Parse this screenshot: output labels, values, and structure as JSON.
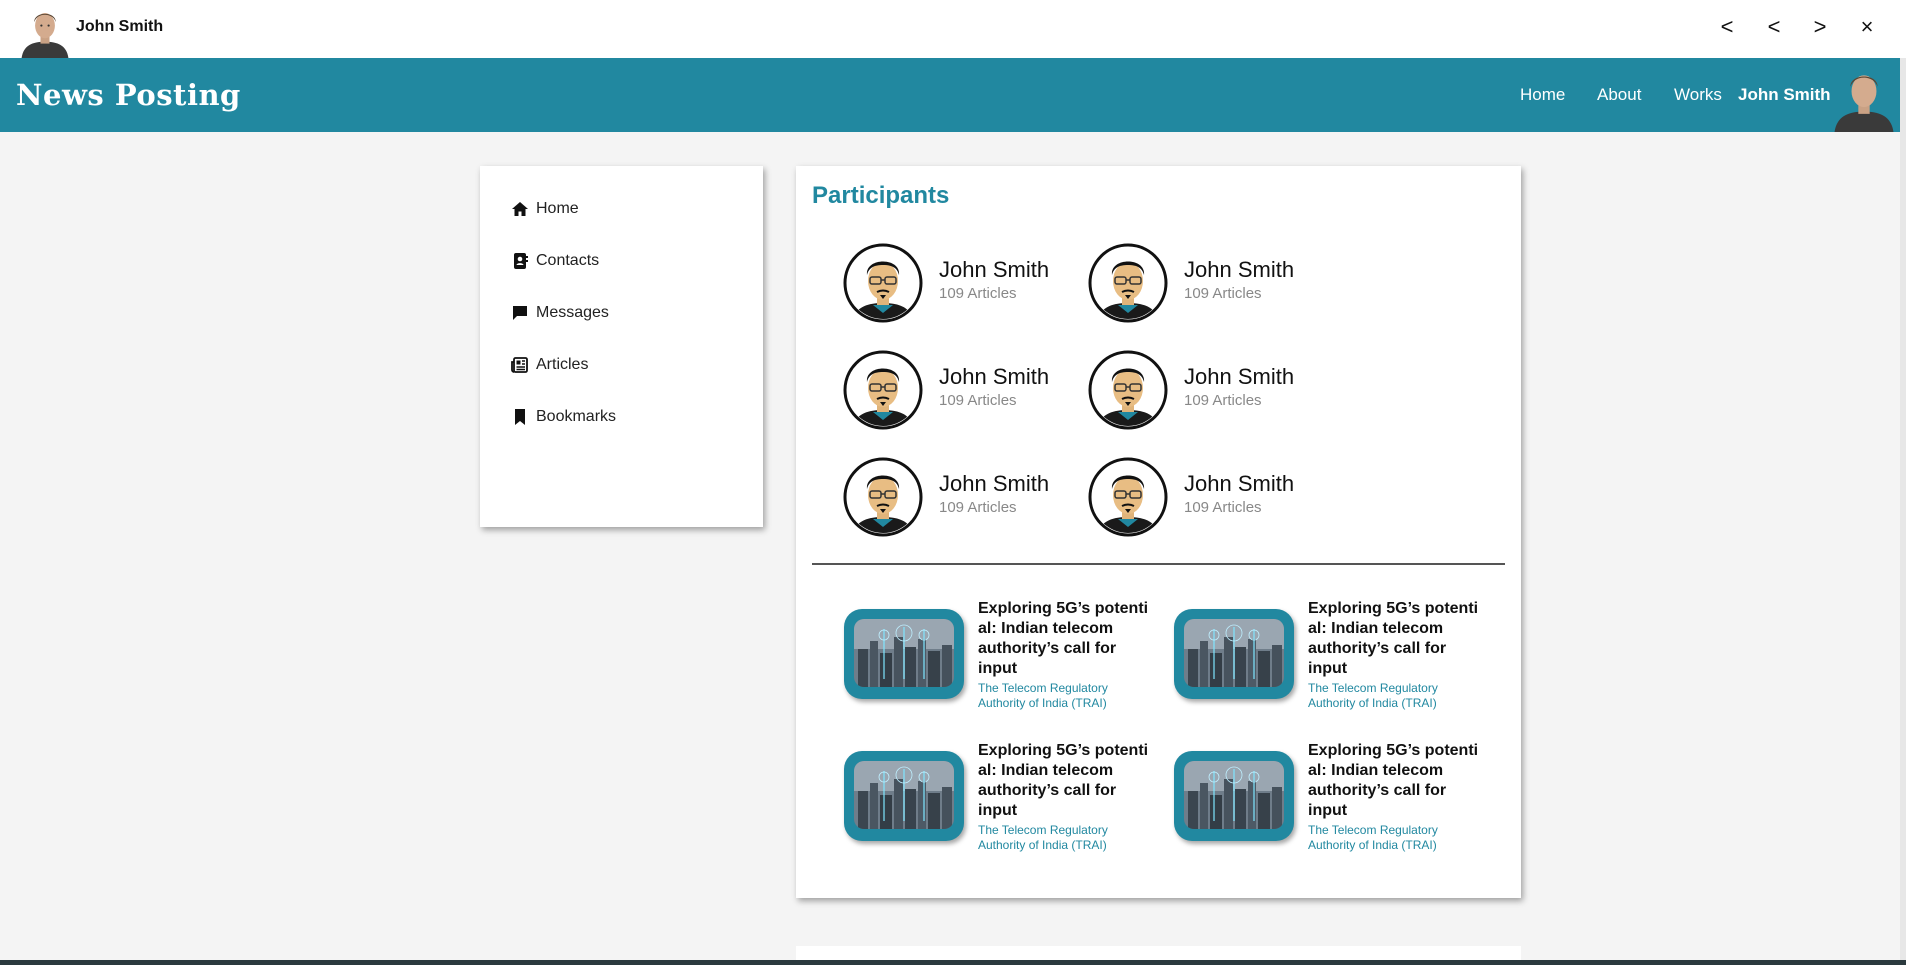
{
  "window": {
    "user_name": "John Smith",
    "controls": [
      "<",
      "<",
      ">",
      "×"
    ]
  },
  "navbar": {
    "brand": "News Posting",
    "links": [
      "Home",
      "About",
      "Works"
    ],
    "user_name": "John Smith"
  },
  "sidebar": {
    "items": [
      {
        "label": "Home",
        "icon": "home-icon"
      },
      {
        "label": "Contacts",
        "icon": "contacts-icon"
      },
      {
        "label": "Messages",
        "icon": "message-icon"
      },
      {
        "label": "Articles",
        "icon": "newspaper-icon"
      },
      {
        "label": "Bookmarks",
        "icon": "bookmark-icon"
      }
    ]
  },
  "main": {
    "title": "Participants",
    "participants": [
      {
        "name": "John Smith",
        "count": "109 Articles"
      },
      {
        "name": "John Smith",
        "count": "109 Articles"
      },
      {
        "name": "John Smith",
        "count": "109 Articles"
      },
      {
        "name": "John Smith",
        "count": "109 Articles"
      },
      {
        "name": "John Smith",
        "count": "109 Articles"
      },
      {
        "name": "John Smith",
        "count": "109 Articles"
      }
    ],
    "articles": [
      {
        "title": "Exploring 5G’s potenti al: Indian telecom authority’s call for input",
        "source": "The Telecom Regulatory Authority of India (TRAI)"
      },
      {
        "title": "Exploring 5G’s potenti al: Indian telecom authority’s call for input",
        "source": "The Telecom Regulatory Authority of India (TRAI)"
      },
      {
        "title": "Exploring 5G’s potenti al: Indian telecom authority’s call for input",
        "source": "The Telecom Regulatory Authority of India (TRAI)"
      },
      {
        "title": "Exploring 5G’s potenti al: Indian telecom authority’s call for input",
        "source": "The Telecom Regulatory Authority of India (TRAI)"
      }
    ]
  },
  "colors": {
    "accent": "#2188a0",
    "background": "#f4f4f4",
    "card": "#ffffff"
  }
}
